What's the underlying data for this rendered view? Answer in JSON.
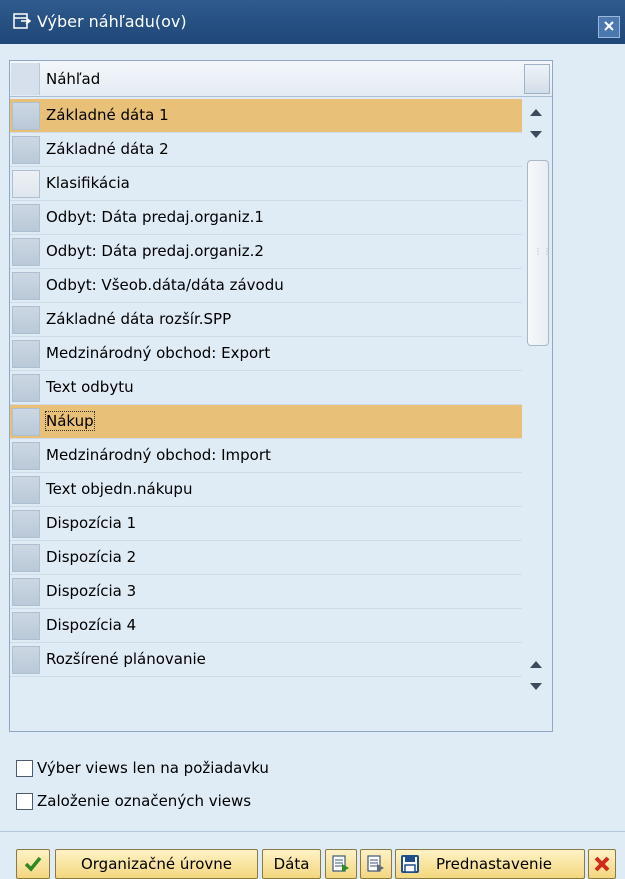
{
  "window": {
    "title": "Výber náhľadu(ov)"
  },
  "table": {
    "column_header": "Náhľad",
    "rows": [
      {
        "label": "Základné dáta 1",
        "selected": true
      },
      {
        "label": "Základné dáta 2",
        "selected": false
      },
      {
        "label": "Klasifikácia",
        "selected": false
      },
      {
        "label": "Odbyt: Dáta predaj.organiz.1",
        "selected": false
      },
      {
        "label": "Odbyt: Dáta predaj.organiz.2",
        "selected": false
      },
      {
        "label": "Odbyt: Všeob.dáta/dáta závodu",
        "selected": false
      },
      {
        "label": "Základné dáta rozšír.SPP",
        "selected": false
      },
      {
        "label": "Medzinárodný obchod: Export",
        "selected": false
      },
      {
        "label": "Text odbytu",
        "selected": false
      },
      {
        "label": "Nákup",
        "selected": true
      },
      {
        "label": "Medzinárodný obchod: Import",
        "selected": false
      },
      {
        "label": "Text objedn.nákupu",
        "selected": false
      },
      {
        "label": "Dispozícia 1",
        "selected": false
      },
      {
        "label": "Dispozícia 2",
        "selected": false
      },
      {
        "label": "Dispozícia 3",
        "selected": false
      },
      {
        "label": "Dispozícia 4",
        "selected": false
      },
      {
        "label": "Rozšírené plánovanie",
        "selected": false
      }
    ]
  },
  "options": {
    "views_on_request": "Výber views len na požiadavku",
    "create_marked_views": "Založenie označených views"
  },
  "toolbar": {
    "org_levels_label": "Organizačné úrovne",
    "data_label": "Dáta",
    "default_label": "Prednastavenie"
  },
  "colors": {
    "selected_row": "#e8c078",
    "title_bar": "#2f5b8e",
    "button_fill": "#f3d77e",
    "background": "#dfebf5"
  },
  "icons": {
    "title": "select-view-icon",
    "close": "close-icon",
    "confirm": "checkmark-icon",
    "select_all": "select-all-icon",
    "deselect_all": "deselect-all-icon",
    "save": "save-icon",
    "cancel": "cancel-x-icon"
  }
}
